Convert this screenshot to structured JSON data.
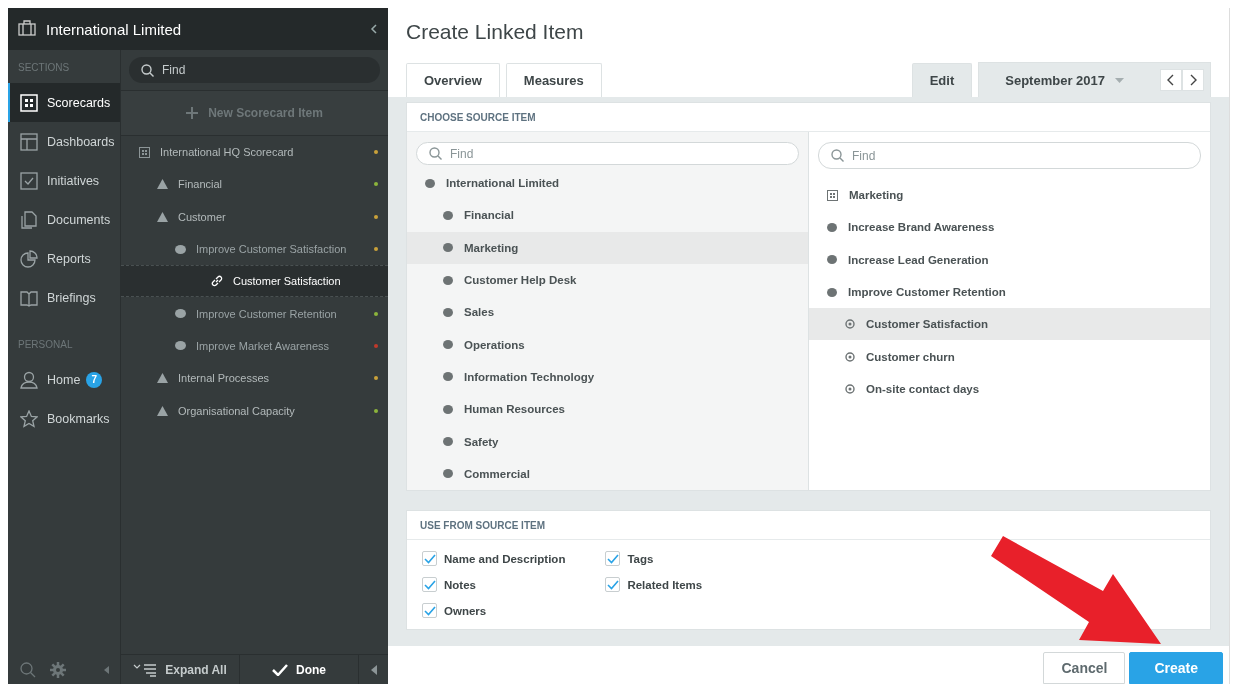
{
  "app": {
    "title": "International Limited"
  },
  "sections_label": "SECTIONS",
  "nav": [
    {
      "label": "Scorecards",
      "selected": true
    },
    {
      "label": "Dashboards",
      "selected": false
    },
    {
      "label": "Initiatives",
      "selected": false
    },
    {
      "label": "Documents",
      "selected": false
    },
    {
      "label": "Reports",
      "selected": false
    },
    {
      "label": "Briefings",
      "selected": false
    }
  ],
  "personal_label": "PERSONAL",
  "personal": [
    {
      "label": "Home",
      "badge": "7"
    },
    {
      "label": "Bookmarks"
    }
  ],
  "tree_panel": {
    "search_placeholder": "Find",
    "new_item": "New Scorecard Item",
    "expand_all": "Expand All",
    "done": "Done",
    "items": [
      {
        "kind": "scorecard",
        "label": "International HQ Scorecard",
        "color": "#c9a13a",
        "selected": false,
        "children": [
          {
            "kind": "perspective",
            "label": "Financial",
            "color": "#8cb43c",
            "selected": false
          },
          {
            "kind": "perspective",
            "label": "Customer",
            "color": "#c9a13a",
            "selected": false,
            "children": [
              {
                "kind": "objective",
                "label": "Improve Customer Satisfaction",
                "color": "#c9a13a",
                "selected": false,
                "children": [
                  {
                    "kind": "link",
                    "label": "Customer Satisfaction",
                    "selected": true
                  }
                ]
              },
              {
                "kind": "objective",
                "label": "Improve Customer Retention",
                "color": "#8cb43c",
                "selected": false
              },
              {
                "kind": "objective",
                "label": "Improve Market Awareness",
                "color": "#c0392b",
                "selected": false
              }
            ]
          },
          {
            "kind": "perspective",
            "label": "Internal Processes",
            "color": "#c9a13a",
            "selected": false
          },
          {
            "kind": "perspective",
            "label": "Organisational Capacity",
            "color": "#8cb43c",
            "selected": false
          }
        ]
      }
    ]
  },
  "main": {
    "title": "Create Linked Item",
    "tabs": [
      {
        "label": "Overview",
        "selected": false
      },
      {
        "label": "Measures",
        "selected": false
      }
    ],
    "edit_tab": {
      "label": "Edit",
      "selected": true
    },
    "period": "September 2017",
    "source": {
      "heading": "CHOOSE SOURCE ITEM",
      "left": {
        "placeholder": "Find",
        "items": [
          {
            "kind": "org",
            "label": "International Limited",
            "selected": false,
            "children": [
              {
                "kind": "org",
                "label": "Financial",
                "selected": false
              },
              {
                "kind": "org",
                "label": "Marketing",
                "selected": true
              },
              {
                "kind": "org",
                "label": "Customer Help Desk",
                "selected": false
              },
              {
                "kind": "org",
                "label": "Sales",
                "selected": false
              },
              {
                "kind": "org",
                "label": "Operations",
                "selected": false
              },
              {
                "kind": "org",
                "label": "Information Technology",
                "selected": false
              },
              {
                "kind": "org",
                "label": "Human Resources",
                "selected": false
              },
              {
                "kind": "org",
                "label": "Safety",
                "selected": false
              },
              {
                "kind": "org",
                "label": "Commercial",
                "selected": false
              }
            ]
          }
        ]
      },
      "right": {
        "placeholder": "Find",
        "items": [
          {
            "kind": "scorecard",
            "label": "Marketing",
            "selected": false
          },
          {
            "kind": "objective",
            "label": "Increase Brand Awareness",
            "selected": false
          },
          {
            "kind": "objective",
            "label": "Increase Lead Generation",
            "selected": false
          },
          {
            "kind": "objective",
            "label": "Improve Customer Retention",
            "selected": false,
            "children": [
              {
                "kind": "measure",
                "label": "Customer Satisfaction",
                "selected": true
              },
              {
                "kind": "measure",
                "label": "Customer churn",
                "selected": false
              },
              {
                "kind": "measure",
                "label": "On-site contact days",
                "selected": false
              }
            ]
          }
        ]
      }
    },
    "use": {
      "heading": "USE FROM SOURCE ITEM",
      "columns": [
        [
          {
            "label": "Name and Description",
            "checked": true
          },
          {
            "label": "Notes",
            "checked": true
          },
          {
            "label": "Owners",
            "checked": true
          }
        ],
        [
          {
            "label": "Tags",
            "checked": true
          },
          {
            "label": "Related Items",
            "checked": true
          }
        ]
      ]
    },
    "buttons": [
      {
        "kind": "secondary",
        "label": "Cancel"
      },
      {
        "kind": "primary",
        "label": "Create"
      }
    ]
  }
}
